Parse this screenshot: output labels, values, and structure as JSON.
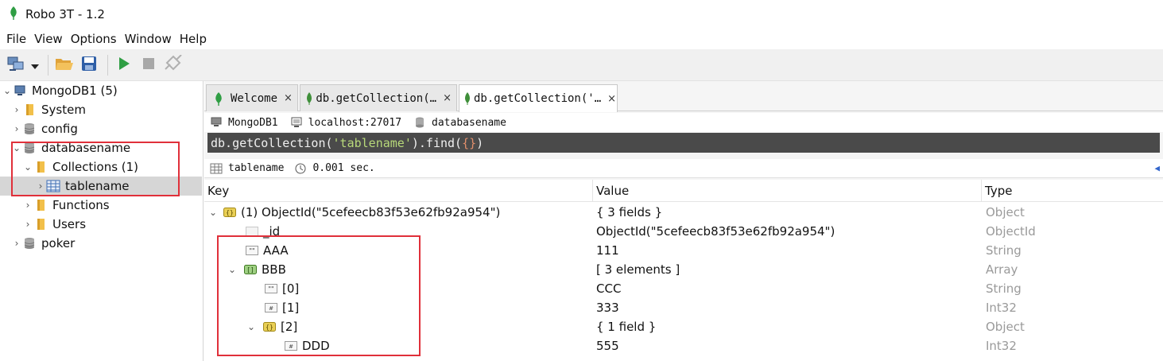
{
  "window": {
    "title": "Robo 3T - 1.2",
    "icon": "robo3t-leaf-icon"
  },
  "menu": [
    "File",
    "View",
    "Options",
    "Window",
    "Help"
  ],
  "toolbar": {
    "buttons": [
      "connect-icon",
      "dropdown-arrow-icon",
      "open-folder-icon",
      "save-icon",
      "run-icon",
      "stop-icon",
      "rotate-icon"
    ]
  },
  "sidebar": {
    "items": [
      {
        "label": "MongoDB1 (5)",
        "icon": "server-icon",
        "chevron": "down",
        "level": 0
      },
      {
        "label": "System",
        "icon": "folder-icon",
        "chevron": "right",
        "level": 1
      },
      {
        "label": "config",
        "icon": "database-icon",
        "chevron": "right",
        "level": 1
      },
      {
        "label": "databasename",
        "icon": "database-icon",
        "chevron": "down",
        "level": 1
      },
      {
        "label": "Collections (1)",
        "icon": "folder-icon",
        "chevron": "down",
        "level": 2
      },
      {
        "label": "tablename",
        "icon": "table-icon",
        "chevron": "right",
        "level": 3,
        "selected": true
      },
      {
        "label": "Functions",
        "icon": "folder-icon",
        "chevron": "right",
        "level": 2
      },
      {
        "label": "Users",
        "icon": "folder-icon",
        "chevron": "right",
        "level": 2
      },
      {
        "label": "poker",
        "icon": "database-icon",
        "chevron": "right",
        "level": 1
      }
    ]
  },
  "tabs": [
    {
      "label": "Welcome",
      "icon": "robo3t-leaf-icon",
      "close": "×",
      "active": false
    },
    {
      "label": "db.getCollection(…",
      "icon": "mongo-leaf-icon",
      "close": "×",
      "active": false
    },
    {
      "label": "db.getCollection('…",
      "icon": "mongo-leaf-icon",
      "close": "×",
      "active": true
    }
  ],
  "connection": {
    "server": "MongoDB1",
    "host": "localhost:27017",
    "database": "databasename"
  },
  "query": {
    "prefix": "db.getCollection(",
    "collection": "'tablename'",
    "middle": ").find(",
    "braces": "{}",
    "suffix": ")"
  },
  "result": {
    "collection": "tablename",
    "time": "0.001 sec.",
    "collapse_icon": "◀"
  },
  "grid": {
    "columns": [
      "Key",
      "Value",
      "Type"
    ],
    "rows": [
      {
        "key": "(1) ObjectId(\"5cefeecb83f53e62fb92a954\")",
        "value": "{ 3 fields }",
        "type": "Object",
        "depth": 0,
        "chevron": "down",
        "icon": "object-icon"
      },
      {
        "key": "_id",
        "value": "ObjectId(\"5cefeecb83f53e62fb92a954\")",
        "type": "ObjectId",
        "depth": 1,
        "chevron": "",
        "icon": "id-icon"
      },
      {
        "key": "AAA",
        "value": "111",
        "type": "String",
        "depth": 1,
        "chevron": "",
        "icon": "string-icon"
      },
      {
        "key": "BBB",
        "value": "[ 3 elements ]",
        "type": "Array",
        "depth": 1,
        "chevron": "down",
        "icon": "array-icon"
      },
      {
        "key": "[0]",
        "value": "CCC",
        "type": "String",
        "depth": 2,
        "chevron": "",
        "icon": "string-icon"
      },
      {
        "key": "[1]",
        "value": "333",
        "type": "Int32",
        "depth": 2,
        "chevron": "",
        "icon": "int-icon"
      },
      {
        "key": "[2]",
        "value": "{ 1 field }",
        "type": "Object",
        "depth": 2,
        "chevron": "down",
        "icon": "object-icon"
      },
      {
        "key": "DDD",
        "value": "555",
        "type": "Int32",
        "depth": 3,
        "chevron": "",
        "icon": "int-icon"
      }
    ]
  },
  "colors": {
    "highlight": "#e0303a",
    "leaf": "#2f9e44",
    "query_bg": "#4a4a4a",
    "type_text": "#9a9a9a"
  }
}
